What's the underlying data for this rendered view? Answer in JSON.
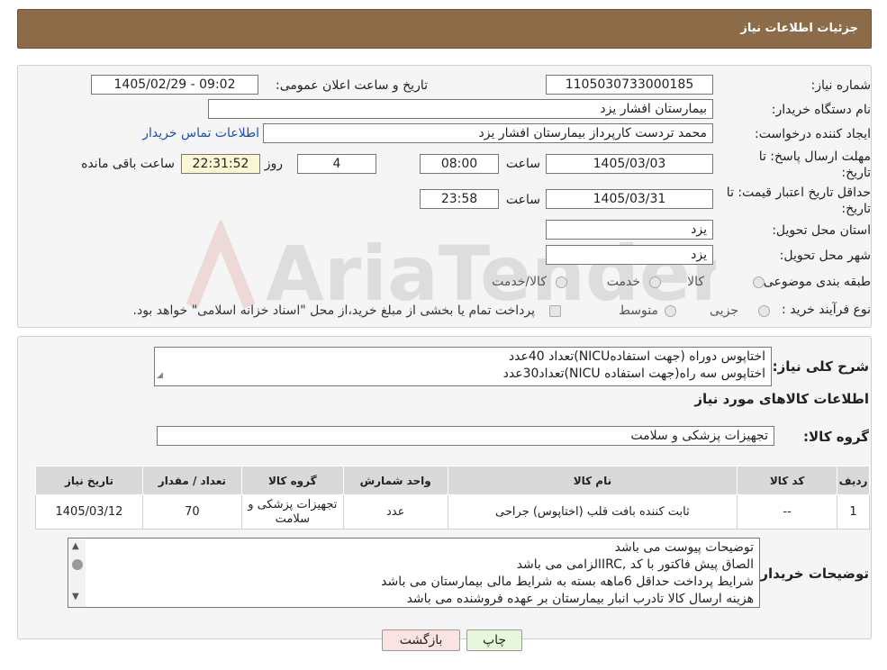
{
  "header": {
    "title": "جزئیات اطلاعات نیاز"
  },
  "form": {
    "need_number_label": "شماره نیاز:",
    "need_number": "1105030733000185",
    "announce_label": "تاریخ و ساعت اعلان عمومی:",
    "announce_value": "1405/02/29 - 09:02",
    "buyer_org_label": "نام دستگاه خریدار:",
    "buyer_org": "بیمارستان افشار یزد",
    "creator_label": "ایجاد کننده درخواست:",
    "creator": "محمد تردست کارپرداز بیمارستان افشار یزد",
    "contact_link": "اطلاعات تماس خریدار",
    "deadline_label_1": "مهلت ارسال پاسخ: تا",
    "deadline_label_2": "تاریخ:",
    "deadline_date": "1405/03/03",
    "time_label": "ساعت",
    "deadline_time": "08:00",
    "days_value": "4",
    "days_label": "روز و",
    "remaining_time": "22:31:52",
    "remaining_label": "ساعت باقی مانده",
    "validity_label_1": "حداقل تاریخ اعتبار قیمت: تا",
    "validity_label_2": "تاریخ:",
    "validity_date": "1405/03/31",
    "validity_time": "23:58",
    "province_label": "استان محل تحویل:",
    "province": "یزد",
    "city_label": "شهر محل تحویل:",
    "city": "یزد",
    "category_label": "طبقه بندی موضوعی:",
    "category_options": [
      "کالا",
      "خدمت",
      "کالا/خدمت"
    ],
    "process_label": "نوع فرآیند خرید :",
    "process_options": [
      "جزیی",
      "متوسط"
    ],
    "process_note": "پرداخت تمام یا بخشی از مبلغ خرید،از محل \"اسناد خزانه اسلامی\" خواهد بود."
  },
  "summary": {
    "label": "شرح کلی نیاز:",
    "lines": [
      "اختاپوس دوراه (جهت استفادهNICU)تعداد 40عدد",
      "اختاپوس سه راه(جهت استفاده NICU)تعداد30عدد"
    ]
  },
  "goods_info": {
    "heading": "اطلاعات کالاهای مورد نیاز",
    "group_label": "گروه کالا:",
    "group_value": "تجهیزات پزشکی و سلامت"
  },
  "table": {
    "headers": [
      "ردیف",
      "کد کالا",
      "نام کالا",
      "واحد شمارش",
      "گروه کالا",
      "تعداد / مقدار",
      "تاریخ نیاز"
    ],
    "rows": [
      [
        "1",
        "--",
        "ثابت کننده بافت قلب (اختاپوس) جراحی",
        "عدد",
        "تجهیزات پزشکی و سلامت",
        "70",
        "1405/03/12"
      ]
    ]
  },
  "buyer_notes": {
    "label": "توضیحات خریدار:",
    "lines": [
      "توضیحات پیوست می باشد",
      "الصاق پیش فاکتور با کد  ,IRCالزامی می باشد",
      "شرایط پرداخت حداقل 6ماهه بسته به شرایط مالی بیمارستان می باشد",
      "هزینه ارسال کالا تادرب انبار بیمارستان بر عهده فروشنده می باشد"
    ]
  },
  "buttons": {
    "print": "چاپ",
    "back": "بازگشت"
  },
  "watermark_text": "AriaTender.neT",
  "colors": {
    "header": "#8b6b48",
    "link": "#1a4fb3",
    "print_btn": "#e6f7dc",
    "back_btn": "#fbe3e3"
  }
}
